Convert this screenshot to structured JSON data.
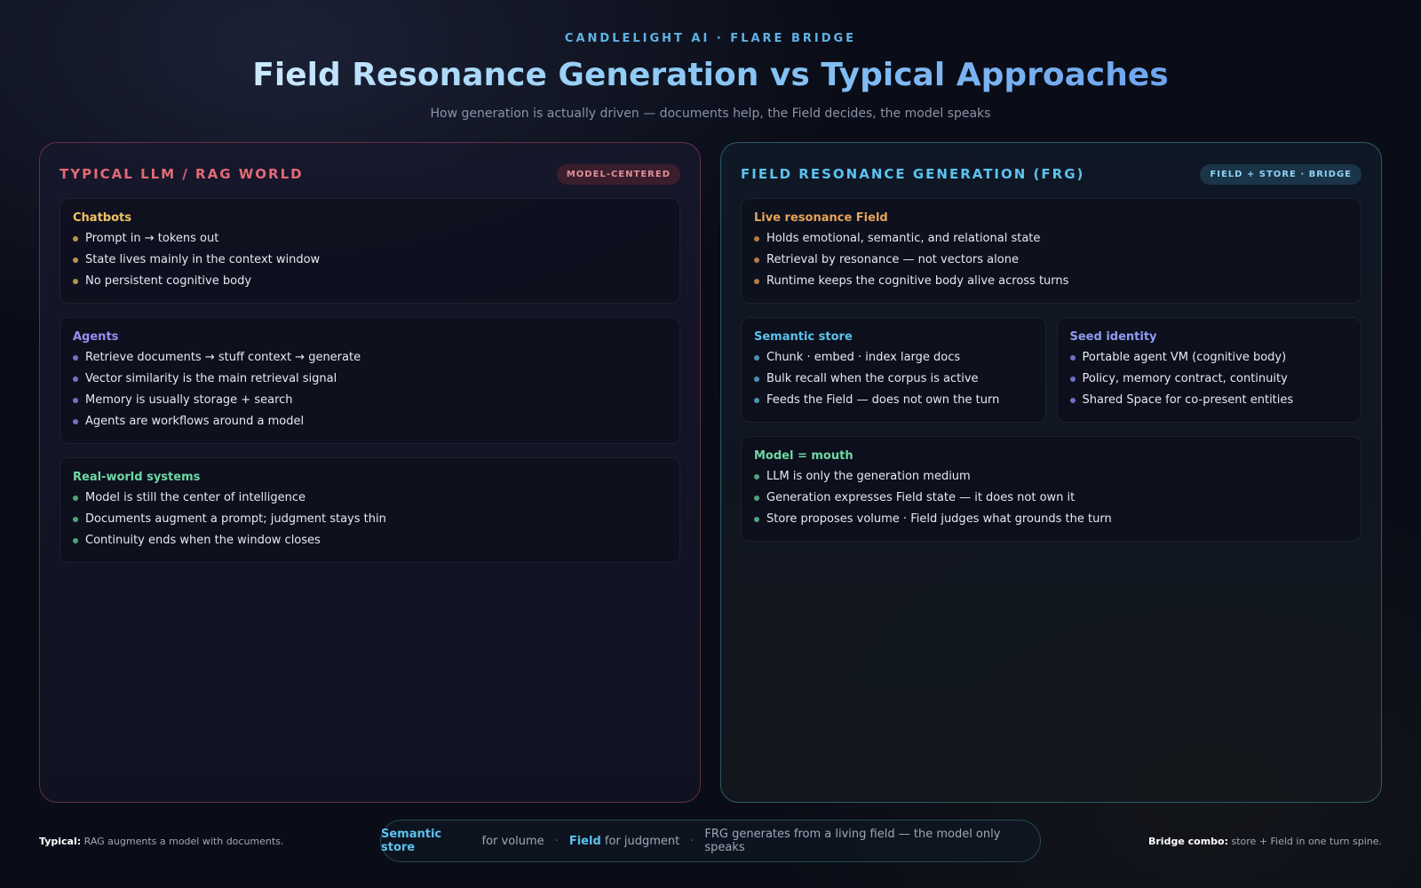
{
  "header": {
    "eyebrow": "CANDLELIGHT AI · FLARE BRIDGE",
    "title": "Field Resonance Generation vs Typical Approaches",
    "subtitle": "How generation is actually driven — documents help, the Field decides, the model speaks"
  },
  "left_panel": {
    "title": "TYPICAL LLM / RAG WORLD",
    "badge": "MODEL-CENTERED",
    "cards": [
      {
        "title": "Chatbots",
        "items": [
          "Prompt in → tokens out",
          "State lives mainly in the context window",
          "No persistent cognitive body"
        ]
      },
      {
        "title": "Agents",
        "items": [
          "Retrieve documents → stuff context → generate",
          "Vector similarity is the main retrieval signal",
          "Memory is usually storage + search",
          "Agents are workflows around a model"
        ]
      },
      {
        "title": "Real-world systems",
        "items": [
          "Model is still the center of intelligence",
          "Documents augment a prompt; judgment stays thin",
          "Continuity ends when the window closes"
        ]
      }
    ]
  },
  "right_panel": {
    "title": "FIELD RESONANCE GENERATION (FRG)",
    "badge": "FIELD + STORE · BRIDGE",
    "cards": [
      {
        "title": "Live resonance Field",
        "items": [
          "Holds emotional, semantic, and relational state",
          "Retrieval by resonance — not vectors alone",
          "Runtime keeps the cognitive body alive across turns"
        ]
      },
      {
        "title": "Semantic store",
        "items": [
          "Chunk · embed · index large docs",
          "Bulk recall when the corpus is active",
          "Feeds the Field — does not own the turn"
        ]
      },
      {
        "title": "Seed identity",
        "items": [
          "Portable agent VM (cognitive body)",
          "Policy, memory contract, continuity",
          "Shared Space for co-present entities"
        ]
      },
      {
        "title": "Model = mouth",
        "items": [
          "LLM is only the generation medium",
          "Generation expresses Field state — it does not own it",
          "Store proposes volume · Field judges what grounds the turn"
        ]
      }
    ]
  },
  "footer": {
    "left_label": "Typical:",
    "left_text": " RAG augments a model with documents.",
    "pill": {
      "store_hl": "Semantic store",
      "store_text": " for volume",
      "sep": "·",
      "field_hl": "Field",
      "field_text": " for judgment",
      "tail": "FRG generates from a living field — the model only speaks"
    },
    "right_label": "Bridge combo:",
    "right_text": " store + Field in one turn spine."
  }
}
